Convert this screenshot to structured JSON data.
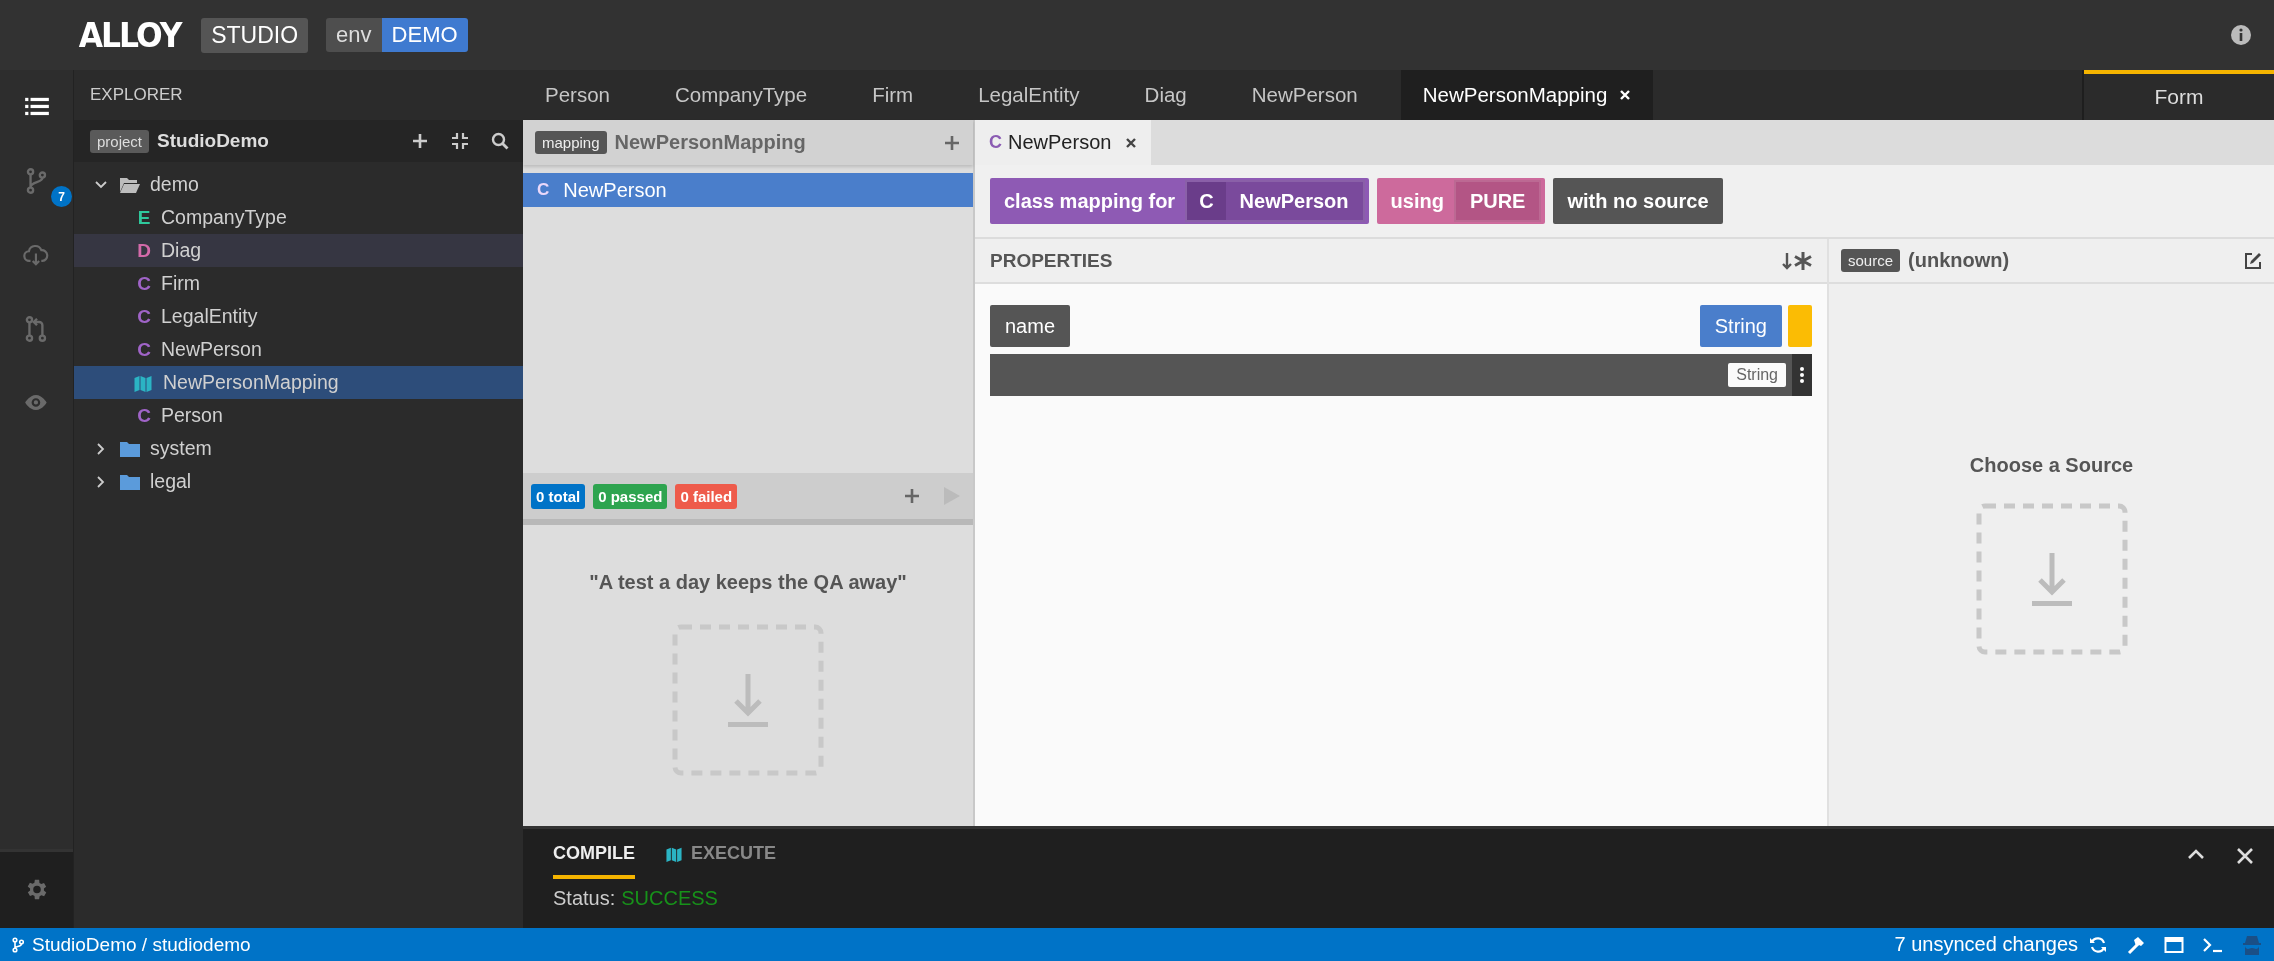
{
  "header": {
    "logo": "ALLOY",
    "product": "STUDIO",
    "env_label": "env",
    "env_name": "DEMO"
  },
  "activity_bar": [
    {
      "kind": "explorer",
      "selected": true
    },
    {
      "kind": "changes",
      "selected": false,
      "badge": "7"
    },
    {
      "kind": "cloud",
      "selected": false
    },
    {
      "kind": "review",
      "selected": false
    },
    {
      "kind": "watch",
      "selected": false
    },
    {
      "kind": "settings",
      "selected": false
    }
  ],
  "explorer": {
    "title": "EXPLORER",
    "project_label": "project",
    "project_name": "StudioDemo",
    "tree": [
      {
        "kind": "folder",
        "label": "demo",
        "expanded": true,
        "children": [
          {
            "kind": "element",
            "letter": "E",
            "color": "#2fc99c",
            "label": "CompanyType",
            "selected": false,
            "hovered": false
          },
          {
            "kind": "element",
            "letter": "D",
            "color": "#d36aa9",
            "label": "Diag",
            "selected": false,
            "hovered": true
          },
          {
            "kind": "element",
            "letter": "C",
            "color": "#a064c8",
            "label": "Firm",
            "selected": false,
            "hovered": false
          },
          {
            "kind": "element",
            "letter": "C",
            "color": "#a064c8",
            "label": "LegalEntity",
            "selected": false,
            "hovered": false
          },
          {
            "kind": "element",
            "letter": "C",
            "color": "#a064c8",
            "label": "NewPerson",
            "selected": false,
            "hovered": false
          },
          {
            "kind": "mapping",
            "label": "NewPersonMapping",
            "selected": true,
            "hovered": false
          },
          {
            "kind": "element",
            "letter": "C",
            "color": "#a064c8",
            "label": "Person",
            "selected": false,
            "hovered": false
          }
        ]
      },
      {
        "kind": "folder",
        "label": "system",
        "expanded": false
      },
      {
        "kind": "folder",
        "label": "legal",
        "expanded": false
      }
    ]
  },
  "editor_tabs": [
    {
      "label": "Person",
      "selected": false
    },
    {
      "label": "CompanyType",
      "selected": false
    },
    {
      "label": "Firm",
      "selected": false
    },
    {
      "label": "LegalEntity",
      "selected": false
    },
    {
      "label": "Diag",
      "selected": false
    },
    {
      "label": "NewPerson",
      "selected": false
    },
    {
      "label": "NewPersonMapping",
      "selected": true
    }
  ],
  "side_tabs": [
    {
      "label": "Form",
      "selected": true
    }
  ],
  "mapping_explorer": {
    "badge": "mapping",
    "title": "NewPersonMapping",
    "items": [
      {
        "letter": "C",
        "label": "NewPerson",
        "selected": true
      }
    ],
    "test_counts": [
      {
        "text": "0 total",
        "color": "#0073c7"
      },
      {
        "text": "0 passed",
        "color": "#2ea44f"
      },
      {
        "text": "0 failed",
        "color": "#ee5b4b"
      }
    ],
    "run_disabled": true,
    "empty_message": "\"A test a day keeps the QA away\""
  },
  "mapping_editor": {
    "tabs": [
      {
        "letter": "C",
        "label": "NewPerson",
        "selected": true
      }
    ],
    "chips": [
      {
        "kind": "class",
        "label": "class mapping for",
        "letter": "C",
        "value": "NewPerson"
      },
      {
        "kind": "store",
        "label": "using",
        "value": "PURE"
      },
      {
        "kind": "plain",
        "label": "with no source"
      }
    ],
    "properties_title": "PROPERTIES",
    "properties": [
      {
        "name": "name",
        "type": "String",
        "transform_type": "String",
        "flagged": true
      }
    ],
    "source_badge": "source",
    "source_value": "(unknown)",
    "source_message": "Choose a Source"
  },
  "bottom_panel": {
    "tabs": [
      {
        "kind": "plain",
        "label": "COMPILE",
        "selected": true
      },
      {
        "kind": "mapping",
        "label": "EXECUTE",
        "selected": false
      }
    ],
    "status_label": "Status:",
    "status_value": "SUCCESS"
  },
  "status_bar": {
    "workspace": "StudioDemo / studiodemo",
    "changes": "7 unsynced changes"
  }
}
